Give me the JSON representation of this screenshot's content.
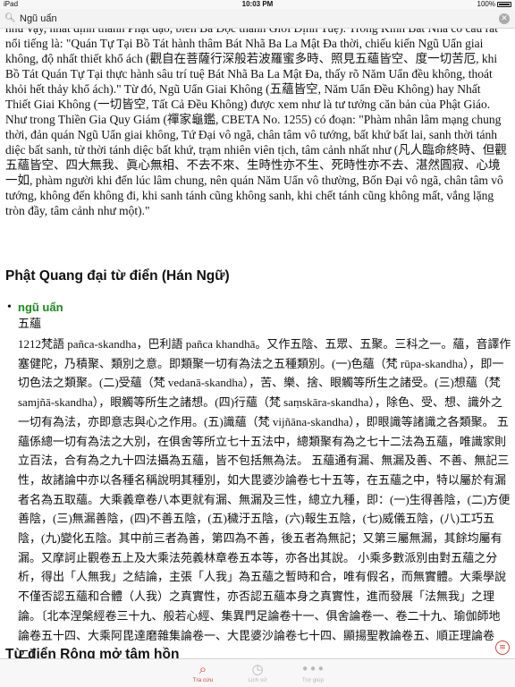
{
  "status_bar": {
    "device": "iPad",
    "time": "10:03 PM",
    "battery": "100%"
  },
  "search": {
    "value": "Ngũ uẩn",
    "search_icon": "search-icon",
    "clear_icon": "clear-icon"
  },
  "article": {
    "paragraph": "như vậy, nhất định thành Phật đạo, biến Ba Độc thành Giới Định Tuệ). Trong Kinh Bát Nhã có câu rất nổi tiếng là: \"Quán Tự Tại Bồ Tát hành thâm Bát Nhã Ba La Mật Đa thời, chiếu kiến Ngũ Uẩn giai không, độ nhất thiết khổ ách (觀自在菩薩行深般若波羅蜜多時、照見五蘊皆空、度一切苦厄, khi Bồ Tát Quán Tự Tại thực hành sâu trí tuệ Bát Nhã Ba La Mật Đa, thấy rõ Năm Uẩn đều không, thoát khỏi hết thảy khổ ách).\" Từ đó, Ngũ Uẩn Giai Không (五蘊皆空, Năm Uẩn Đều Không) hay Nhất Thiết Giai Không (一切皆空, Tất Cả Đều Không) được xem như là tư tưởng căn bản của Phật Giáo. Như trong Thiền Gia Quy Giám (禪家龜鑑, CBETA No. 1255) có đoạn: \"Phàm nhân lâm mạng chung thời, đản quán Ngũ Uẩn giai không, Tứ Đại vô ngã, chân tâm vô tướng, bất khứ bất lai, sanh thời tánh diệc bất sanh, tử thời tánh diệc bất khứ, trạm nhiên viên tịch, tâm cảnh nhất như (凡人臨命終時、但觀五蘊皆空、四大無我、眞心無相、不去不來、生時性亦不生、死時性亦不去、湛然圓寂、心境一如, phàm người khi đến lúc lâm chung, nên quán Năm Uẩn vô thường, Bốn Đại vô ngã, chân tâm vô tướng, không đến không đi, khi sanh tánh cũng không sanh, khi chết tánh cũng không mất, vắng lặng tròn đầy, tâm cảnh như một).\"",
    "section_title": "Phật Quang đại từ điển (Hán Ngữ)",
    "entry": {
      "headword": "ngũ uẩn",
      "hanzi": "五蘊",
      "body": "1212梵語 pañca-skandha，巴利語 pañca khandhā。又作五陰、五眾、五聚。三科之一。蘊，音譯作塞健陀，乃積聚、類別之意。即類聚一切有為法之五種類別。(一)色蘊（梵 rūpa-skandha），即一切色法之類聚。(二)受蘊（梵 vedanā-skandha），苦、樂、捨、眼觸等所生之諸受。(三)想蘊（梵 samjñā-skandha），眼觸等所生之諸想。(四)行蘊（梵 saṃskāra-skandha），除色、受、想、識外之一切有為法，亦即意志與心之作用。(五)識蘊（梵 vijñāna-skandha），即眼識等諸識之各類聚。 五蘊係總一切有為法之大別，在俱舍等所立七十五法中，總類聚有為之七十二法為五蘊，唯識家則立百法，合有為之九十四法攝為五蘊，皆不包括無為法。 五蘊通有漏、無漏及善、不善、無記三性，故諸論中亦以各種名稱說明其種別，如大毘婆沙論卷七十五等，在五蘊之中，特以屬於有漏者名為五取蘊。大乘義章卷八本更就有漏、無漏及三性，總立九種，即：(一)生得善陰，(二)方便善陰，(三)無漏善陰，(四)不善五陰，(五)穢汙五陰，(六)報生五陰，(七)威儀五陰，(八)工巧五陰，(九)變化五陰。其中前三者為善，第四為不善，後五者為無記；又第三屬無漏，其餘均屬有漏。又摩訶止觀卷五上及大乘法苑義林章卷五本等，亦各出其說。 小乘多數派別由對五蘊之分析，得出「人無我」之結論，主張「人我」為五蘊之暫時和合，唯有假名，而無實體。大乘學說不僅否認五蘊和合體（人我）之真實性，亦否認五蘊本身之真實性，進而發展「法無我」之理論。〔北本涅槃經卷三十九、般若心經、集異門足論卷十一、俱舍論卷一、卷二十九、瑜伽師地論卷五十四、大乘阿毘達磨雜集論卷一、大毘婆沙論卷七十四、顯揚聖教論卷五、順正理論卷二〕"
    },
    "next_section_title": "Từ điển Rộng mở tâm hồn"
  },
  "floating_menu": {
    "icon": "list-icon"
  },
  "tab_bar": {
    "tabs": [
      {
        "label": "Tra cứu",
        "icon": "search-icon",
        "active": true,
        "color": "#d0453a"
      },
      {
        "label": "Lịch sử",
        "icon": "clock-icon",
        "active": false,
        "color": "#b8b8b8"
      },
      {
        "label": "Trợ giúp",
        "icon": "more-icon",
        "active": false,
        "color": "#b8b8b8"
      }
    ]
  }
}
